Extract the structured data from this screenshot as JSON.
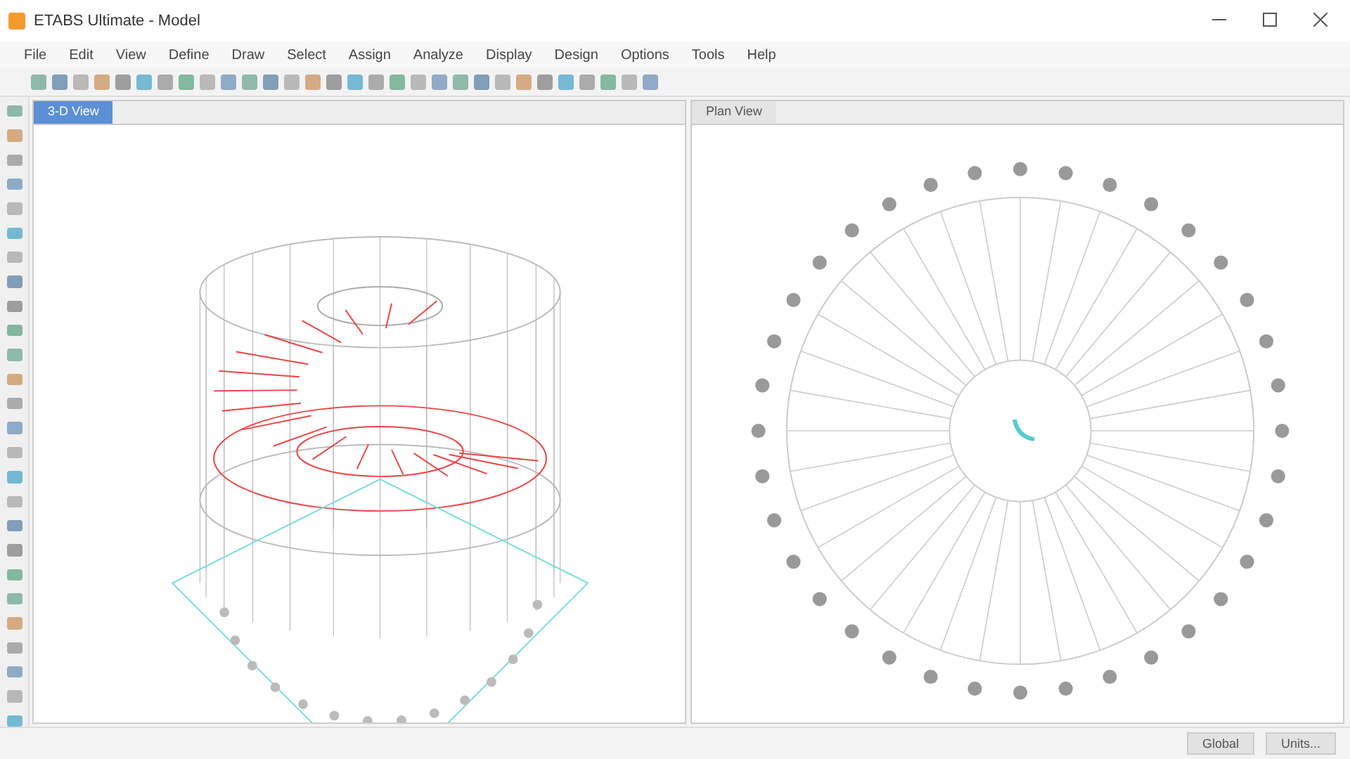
{
  "window": {
    "title": "ETABS Ultimate - Model"
  },
  "menu": [
    "File",
    "Edit",
    "View",
    "Define",
    "Draw",
    "Select",
    "Assign",
    "Analyze",
    "Display",
    "Design",
    "Options",
    "Tools",
    "Help"
  ],
  "tabs": [
    {
      "label": "3-D View",
      "selected": true
    },
    {
      "label": "Plan View",
      "selected": false
    }
  ],
  "status_bar": [
    "Global",
    "Units..."
  ]
}
